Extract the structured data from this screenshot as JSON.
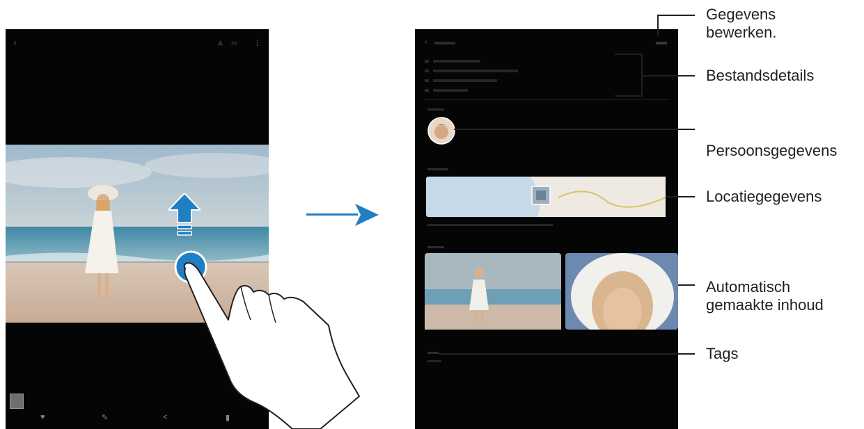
{
  "callouts": {
    "edit_details": [
      "Gegevens",
      "bewerken."
    ],
    "file_details": "Bestandsdetails",
    "person_info": "Persoonsgegevens",
    "location_info": "Locatiegegevens",
    "auto_content": [
      "Automatisch",
      "gemaakte inhoud"
    ],
    "tags": "Tags"
  },
  "icons": {
    "swipe_up": "arrow-up-icon",
    "touch_point": "touch-indicator-icon",
    "hand": "hand-pointer-icon",
    "transition": "arrow-right-icon"
  },
  "colors": {
    "accent_blue": "#1f7fc4",
    "callout_text": "#231f20",
    "screen_bg": "#050505"
  }
}
